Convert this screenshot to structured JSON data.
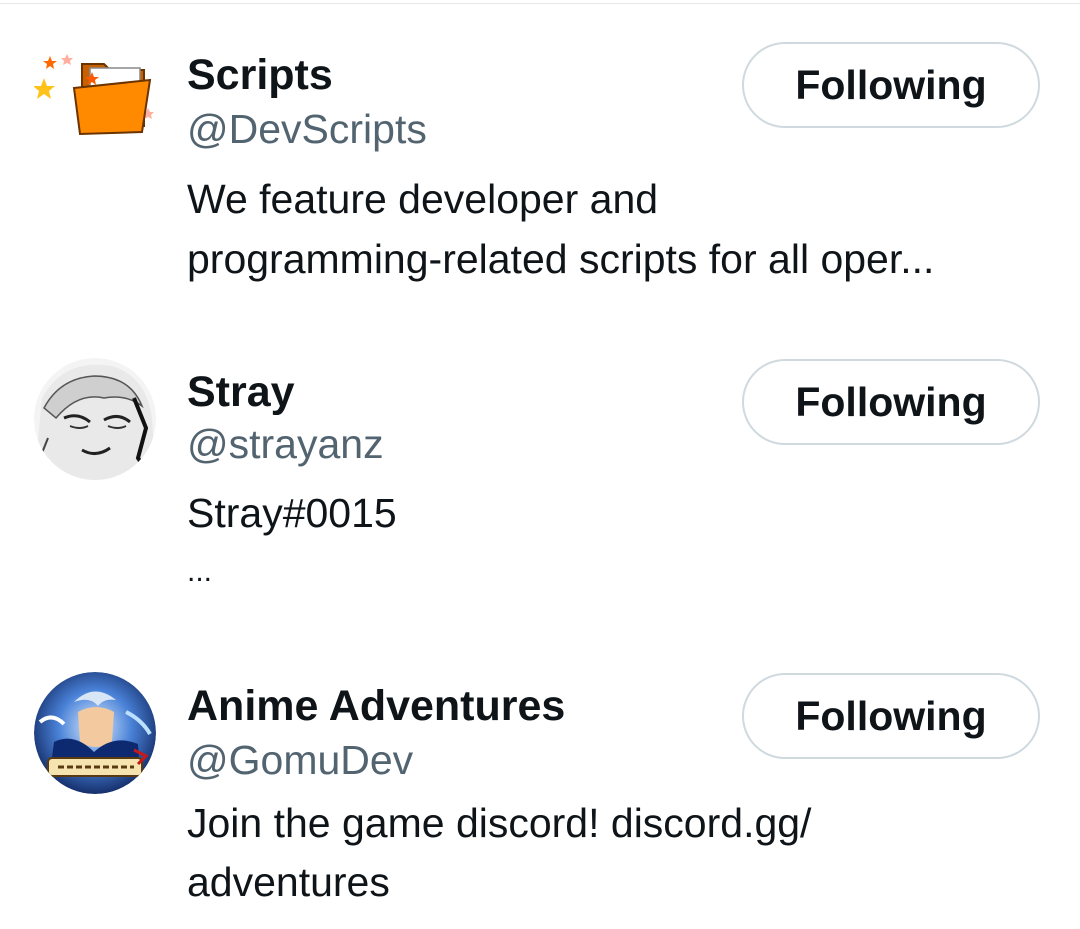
{
  "users": [
    {
      "display_name": "Scripts",
      "handle": "@DevScripts",
      "bio_lines": [
        "We feature developer and",
        "programming-related scripts for all oper..."
      ],
      "follow_label": "Following",
      "avatar_icon": "folder-stars-icon"
    },
    {
      "display_name": "Stray",
      "handle": "@strayanz",
      "bio_lines": [
        "Stray#0015",
        "..."
      ],
      "follow_label": "Following",
      "avatar_icon": "manga-portrait-avatar"
    },
    {
      "display_name": "Anime Adventures",
      "handle": "@GomuDev",
      "bio_lines": [
        "Join the game discord! discord.gg/",
        "adventures"
      ],
      "follow_label": "Following",
      "avatar_icon": "anime-game-avatar"
    }
  ],
  "colors": {
    "text_primary": "#0f1419",
    "text_secondary": "#536471",
    "button_border": "#cfd9de",
    "folder_orange": "#ff8a00",
    "star_yellow": "#ffc21a"
  }
}
